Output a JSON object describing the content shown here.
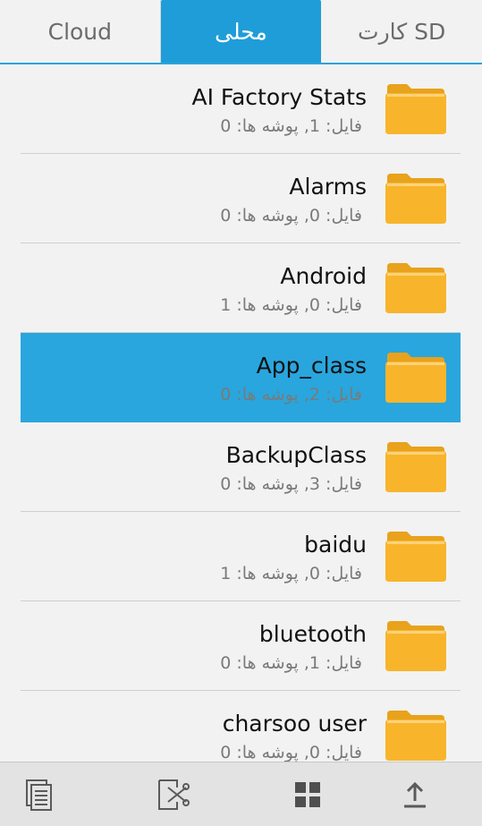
{
  "tabs": [
    {
      "label": "Cloud",
      "active": false
    },
    {
      "label": "محلی",
      "active": true
    },
    {
      "label": "کارت SD",
      "active": false
    }
  ],
  "folders": [
    {
      "name": "AI Factory Stats",
      "meta": "فایل: 1, پوشه ها: 0",
      "selected": false
    },
    {
      "name": "Alarms",
      "meta": "فایل: 0, پوشه ها: 0",
      "selected": false
    },
    {
      "name": "Android",
      "meta": "فایل: 0, پوشه ها: 1",
      "selected": false
    },
    {
      "name": "App_class",
      "meta": "فایل: 2, پوشه ها: 0",
      "selected": true
    },
    {
      "name": "BackupClass",
      "meta": "فایل: 3, پوشه ها: 0",
      "selected": false
    },
    {
      "name": "baidu",
      "meta": "فایل: 0, پوشه ها: 1",
      "selected": false
    },
    {
      "name": "bluetooth",
      "meta": "فایل: 1, پوشه ها: 0",
      "selected": false
    },
    {
      "name": "charsoo user",
      "meta": "فایل: 0, پوشه ها: 0",
      "selected": false
    }
  ],
  "toolbar": {
    "icons": [
      "copy-icon",
      "cut-icon",
      "grid-view-icon",
      "upload-icon"
    ]
  },
  "colors": {
    "accent": "#1f9dd8",
    "selected_row": "#29a6dd",
    "folder": "#f8b52b"
  }
}
